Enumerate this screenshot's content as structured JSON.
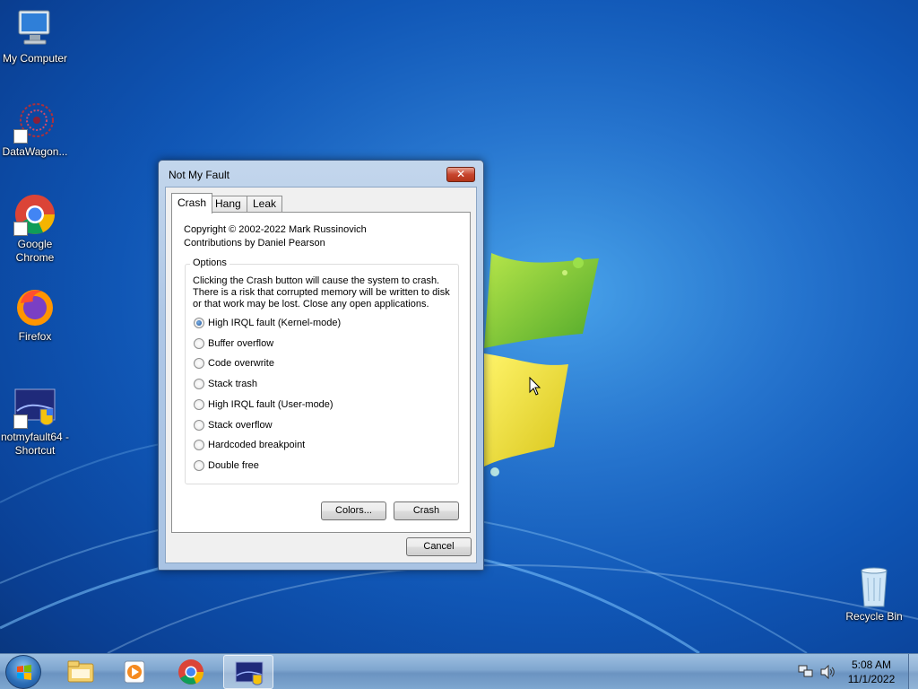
{
  "desktop": {
    "icons": [
      {
        "label": "My Computer",
        "icon": "computer-icon"
      },
      {
        "label": "DataWagon...",
        "icon": "datawagon-icon"
      },
      {
        "label": "Google Chrome",
        "icon": "chrome-icon"
      },
      {
        "label": "Firefox",
        "icon": "firefox-icon"
      },
      {
        "label": "notmyfault64 - Shortcut",
        "icon": "notmyfault-icon"
      },
      {
        "label": "Recycle Bin",
        "icon": "recycle-bin-icon"
      }
    ]
  },
  "dialog": {
    "title": "Not My Fault",
    "close_label": "✕",
    "tabs": [
      {
        "label": "Crash",
        "active": true
      },
      {
        "label": "Hang",
        "active": false
      },
      {
        "label": "Leak",
        "active": false
      }
    ],
    "copyright": "Copyright © 2002-2022 Mark Russinovich",
    "contributions": "Contributions by Daniel Pearson",
    "options_title": "Options",
    "description": "Clicking the Crash button will cause the system to crash. There is a risk that corrupted memory will be written to disk or that work may be lost. Close any open applications.",
    "options": [
      {
        "label": "High IRQL fault (Kernel-mode)",
        "selected": true
      },
      {
        "label": "Buffer overflow",
        "selected": false
      },
      {
        "label": "Code overwrite",
        "selected": false
      },
      {
        "label": "Stack trash",
        "selected": false
      },
      {
        "label": "High IRQL fault (User-mode)",
        "selected": false
      },
      {
        "label": "Stack overflow",
        "selected": false
      },
      {
        "label": "Hardcoded breakpoint",
        "selected": false
      },
      {
        "label": "Double free",
        "selected": false
      }
    ],
    "colors_button": "Colors...",
    "crash_button": "Crash",
    "cancel_button": "Cancel"
  },
  "taskbar": {
    "pinned": [
      {
        "name": "explorer-icon"
      },
      {
        "name": "media-player-icon"
      },
      {
        "name": "chrome-icon"
      },
      {
        "name": "notmyfault-icon",
        "active": true
      }
    ],
    "clock": {
      "time": "5:08 AM",
      "date": "11/1/2022"
    }
  }
}
